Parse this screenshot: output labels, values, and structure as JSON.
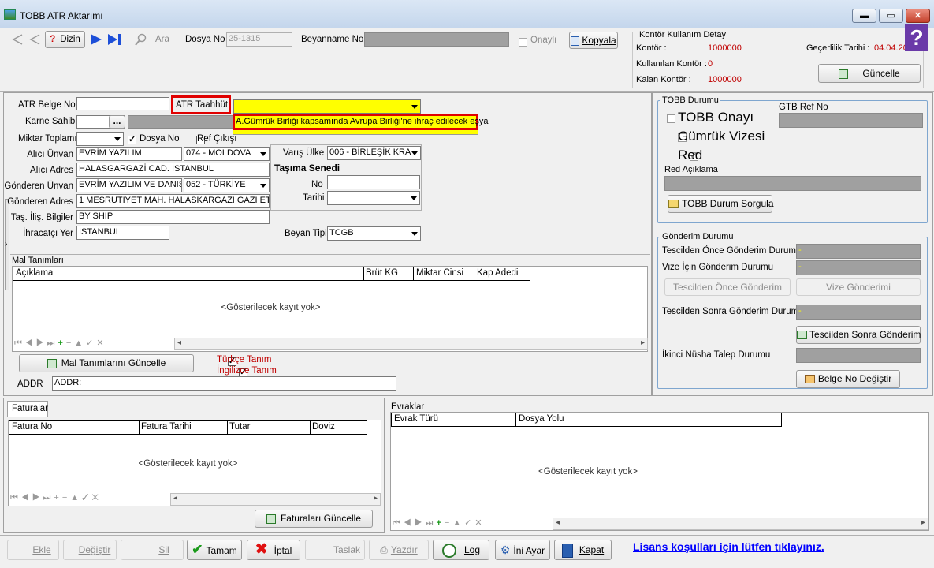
{
  "window": {
    "title": "TOBB ATR Aktarımı",
    "min": "▬",
    "max": "▭",
    "close": "✕"
  },
  "toolbar": {
    "dizin": "Dizin",
    "ara": "Ara",
    "dosya_no_label": "Dosya No",
    "dosya_no_value": "25-1315",
    "beyanname_label": "Beyanname No",
    "onayli_label": "Onaylı",
    "kopyala": "Kopyala"
  },
  "kontor": {
    "title": "Kontör Kullanım Detayı",
    "kontor_label": "Kontör :",
    "kontor_value": "1000000",
    "kullanilan_label": "Kullanılan Kontör :",
    "kullanilan_value": "0",
    "kalan_label": "Kalan Kontör :",
    "kalan_value": "1000000",
    "gecerlilik_label": "Geçerlilik Tarihi :",
    "gecerlilik_value": "04.04.20",
    "guncelle": "Güncelle"
  },
  "form": {
    "atr_belge_no": "ATR Belge No",
    "atr_taahhut": "ATR Taahhüt",
    "atr_taahhut_option": "A.Gümrük Birliği kapsamında Avrupa Birliği'ne ihraç edilecek eşya",
    "karne_sahibi": "Karne Sahibi",
    "karne_btn": "...",
    "miktar_toplami": "Miktar Toplamı",
    "dosya_no_chk": "Dosya No",
    "ref_cikisi": "Ref Çıkışı",
    "alici_unvan_label": "Alıcı Ünvan",
    "alici_unvan": "EVRİM YAZILIM",
    "alici_ulke": "074 - MOLDOVA",
    "alici_adres_label": "Alıcı Adres",
    "alici_adres": "HALASGARGAZİ CAD. İSTANBUL",
    "gonderen_unvan_label": "Gönderen Ünvan",
    "gonderen_unvan": "EVRİM YAZILIM VE DANIŞ",
    "gonderen_ulke": "052 - TÜRKİYE",
    "gonderen_adres_label": "Gönderen Adres",
    "gonderen_adres": "1 MESRUTIYET MAH. HALASKARGAZI GAZI ETH",
    "tas_ilis_label": "Taş. İliş. Bilgiler",
    "tas_ilis": "BY SHIP",
    "ihracatci_yer_label": "İhracatçı Yer",
    "ihracatci_yer": "İSTANBUL",
    "varis_ulke_label": "Varış Ülke",
    "varis_ulke": "006 - BİRLEŞİK KRA",
    "tasima_senedi": "Taşıma Senedi",
    "no_label": "No",
    "tarihi_label": "Tarihi",
    "beyan_tipi_label": "Beyan Tipi",
    "beyan_tipi": "TCGB"
  },
  "mal": {
    "title": "Mal Tanımları",
    "columns": [
      "Açıklama",
      "Brüt KG",
      "Miktar Cinsi",
      "Kap Adedi"
    ],
    "empty": "<Gösterilecek kayıt yok>",
    "guncelle": "Mal Tanımlarını Güncelle",
    "turkce": "Türkçe Tanım",
    "ingilizce": "İngilizce Tanım",
    "addr_label": "ADDR",
    "addr_value": "ADDR:"
  },
  "tobb": {
    "title": "TOBB Durumu",
    "gtb_ref": "GTB Ref No",
    "onay": "TOBB Onayı",
    "vize": "Gümrük Vizesi",
    "red": "Red",
    "red_aciklama": "Red Açıklama",
    "sorgula": "TOBB Durum Sorgula"
  },
  "gonderim": {
    "title": "Gönderim Durumu",
    "once_durum": "Tescilden Önce Gönderim Durumu",
    "once_val": "-",
    "vize_durum": "Vize İçin Gönderim Durumu",
    "vize_val": "-",
    "once_btn": "Tescilden Önce Gönderim",
    "vize_btn": "Vize Gönderimi",
    "sonra_durum": "Tescilden Sonra Gönderim Durumu",
    "sonra_val": "-",
    "sonra_btn": "Tescilden Sonra Gönderim",
    "ikinci_nusha": "İkinci Nüsha Talep Durumu",
    "belge_no_degistir": "Belge No Değiştir"
  },
  "faturalar": {
    "tab": "Faturalar",
    "columns": [
      "Fatura No",
      "Fatura Tarihi",
      "Tutar",
      "Doviz"
    ],
    "empty": "<Gösterilecek kayıt yok>",
    "guncelle": "Faturaları Güncelle"
  },
  "evraklar": {
    "title": "Evraklar",
    "columns": [
      "Evrak Türü",
      "Dosya Yolu"
    ],
    "empty": "<Gösterilecek kayıt yok>"
  },
  "bottom": {
    "ekle": "Ekle",
    "degistir": "Değiştir",
    "sil": "Sil",
    "tamam": "Tamam",
    "iptal": "İptal",
    "taslak": "Taslak",
    "yazdir": "Yazdır",
    "log": "Log",
    "ini_ayar": "İni Ayar",
    "kapat": "Kapat",
    "lisans": "Lisans koşulları için lütfen tıklayınız."
  },
  "colors": {
    "highlight": "#ffff00",
    "alert": "#e00000",
    "accent": "#2a5fb0"
  }
}
